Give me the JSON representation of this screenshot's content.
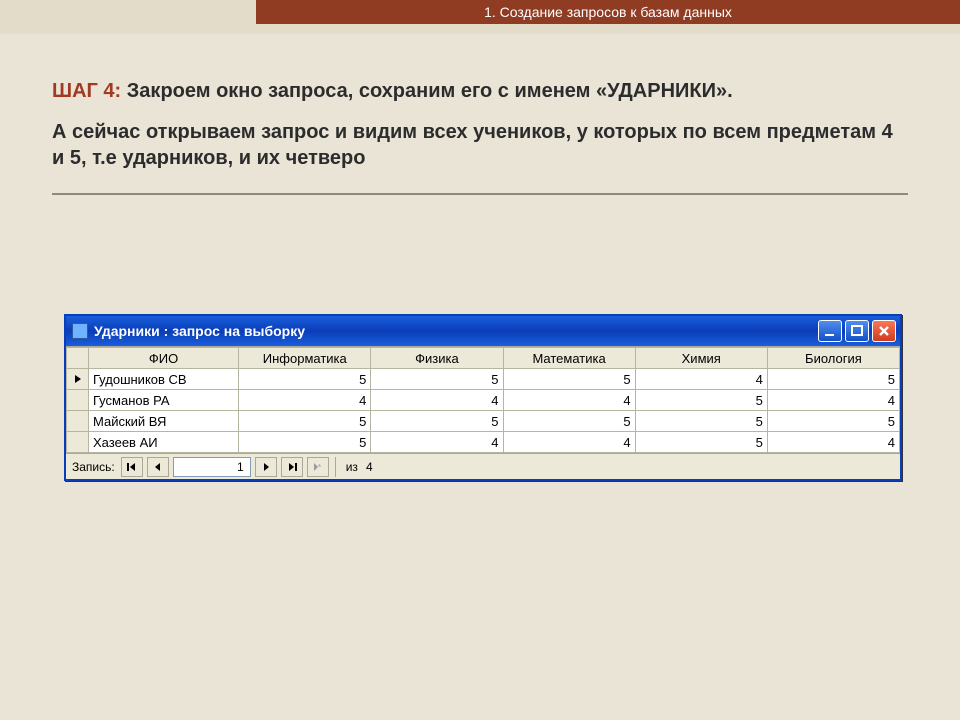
{
  "slide": {
    "header": "1. Создание запросов к базам данных",
    "step_label": "ШАГ 4:",
    "step_text": " Закроем окно запроса, сохраним его с именем «УДАРНИКИ».",
    "body_text": " А сейчас открываем запрос и видим всех учеников, у которых по всем предметам 4 и 5, т.е ударников, и их четверо"
  },
  "window": {
    "title": "Ударники : запрос на выборку",
    "columns": [
      "ФИО",
      "Информатика",
      "Физика",
      "Математика",
      "Химия",
      "Биология"
    ],
    "rows": [
      {
        "fio": "Гудошников СВ",
        "v": [
          5,
          5,
          5,
          4,
          5
        ]
      },
      {
        "fio": "Гусманов РА",
        "v": [
          4,
          4,
          4,
          5,
          4
        ]
      },
      {
        "fio": "Майский ВЯ",
        "v": [
          5,
          5,
          5,
          5,
          5
        ]
      },
      {
        "fio": "Хазеев АИ",
        "v": [
          5,
          4,
          4,
          5,
          4
        ]
      }
    ],
    "nav": {
      "label": "Запись:",
      "current": "1",
      "of_label": "из",
      "total": "4"
    }
  }
}
